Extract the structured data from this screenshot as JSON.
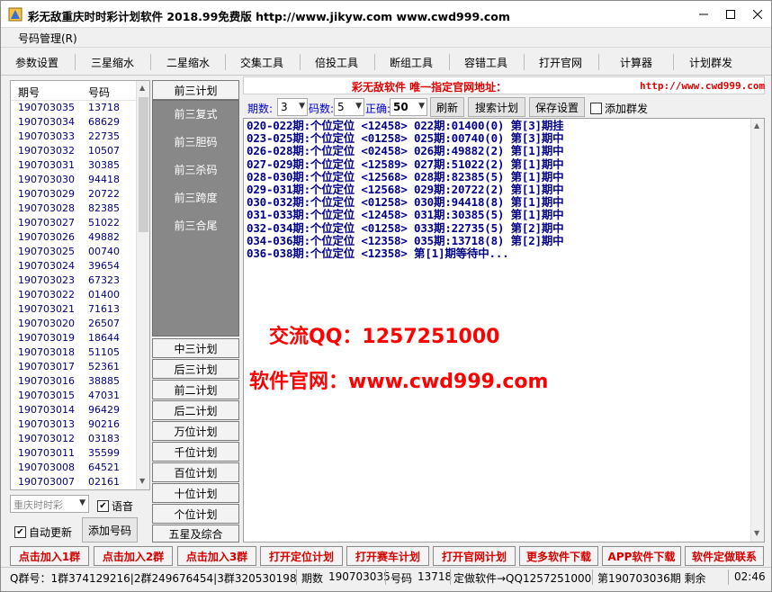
{
  "window": {
    "title": "彩无敌重庆时时彩计划软件 2018.99免费版 http://www.jikyw.com www.cwd999.com"
  },
  "menu": {
    "haoma": "号码管理(R)"
  },
  "toolbar": [
    "参数设置",
    "三星缩水",
    "二星缩水",
    "交集工具",
    "倍投工具",
    "断组工具",
    "容错工具",
    "打开官网",
    "计算器",
    "计划群发"
  ],
  "table": {
    "col_period": "期号",
    "col_number": "号码",
    "rows": [
      [
        "190703035",
        "13718"
      ],
      [
        "190703034",
        "68629"
      ],
      [
        "190703033",
        "22735"
      ],
      [
        "190703032",
        "10507"
      ],
      [
        "190703031",
        "30385"
      ],
      [
        "190703030",
        "94418"
      ],
      [
        "190703029",
        "20722"
      ],
      [
        "190703028",
        "82385"
      ],
      [
        "190703027",
        "51022"
      ],
      [
        "190703026",
        "49882"
      ],
      [
        "190703025",
        "00740"
      ],
      [
        "190703024",
        "39654"
      ],
      [
        "190703023",
        "67323"
      ],
      [
        "190703022",
        "01400"
      ],
      [
        "190703021",
        "71613"
      ],
      [
        "190703020",
        "26507"
      ],
      [
        "190703019",
        "18644"
      ],
      [
        "190703018",
        "51105"
      ],
      [
        "190703017",
        "52361"
      ],
      [
        "190703016",
        "38885"
      ],
      [
        "190703015",
        "47031"
      ],
      [
        "190703014",
        "96429"
      ],
      [
        "190703013",
        "90216"
      ],
      [
        "190703012",
        "03183"
      ],
      [
        "190703011",
        "35599"
      ],
      [
        "190703008",
        "64521"
      ],
      [
        "190703007",
        "02161"
      ]
    ]
  },
  "left_controls": {
    "lottery_select": "重庆时时彩",
    "voice_label": "语音",
    "auto_update_label": "自动更新",
    "add_number_button": "添加号码"
  },
  "plan_column": {
    "top_button": "前三计划",
    "grey_items": [
      "前三复式",
      "前三胆码",
      "前三杀码",
      "前三跨度",
      "前三合尾"
    ],
    "buttons": [
      "中三计划",
      "后三计划",
      "前二计划",
      "后二计划",
      "万位计划",
      "千位计划",
      "百位计划",
      "十位计划",
      "个位计划",
      "五星及综合"
    ]
  },
  "header": {
    "text": "彩无敌软件  唯一指定官网地址：",
    "url": "http://www.cwd999.com"
  },
  "controls": {
    "period_label": "期数:",
    "period_value": "3",
    "code_label": "码数:",
    "code_value": "5",
    "correct_label": "正确:",
    "correct_value": "50",
    "refresh_button": "刷新",
    "search_button": "搜索计划",
    "save_button": "保存设置",
    "group_send_label": "添加群发"
  },
  "output_lines": [
    "020-022期:个位定位 <12458> 022期:01400(0) 第[3]期挂",
    "023-025期:个位定位 <01258> 025期:00740(0) 第[3]期中",
    "026-028期:个位定位 <02458> 026期:49882(2) 第[1]期中",
    "027-029期:个位定位 <12589> 027期:51022(2) 第[1]期中",
    "028-030期:个位定位 <12568> 028期:82385(5) 第[1]期中",
    "029-031期:个位定位 <12568> 029期:20722(2) 第[1]期中",
    "030-032期:个位定位 <01258> 030期:94418(8) 第[1]期中",
    "031-033期:个位定位 <12458> 031期:30385(5) 第[1]期中",
    "032-034期:个位定位 <01258> 033期:22735(5) 第[2]期中",
    "034-036期:个位定位 <12358> 035期:13718(8) 第[2]期中",
    "036-038期:个位定位 <12358> 第[1]期等待中..."
  ],
  "promo": {
    "qq": "交流QQ：1257251000",
    "site": "软件官网：www.cwd999.com"
  },
  "bottom_buttons": [
    "点击加入1群",
    "点击加入2群",
    "点击加入3群",
    "打开定位计划",
    "打开赛车计划",
    "打开官网计划",
    "更多软件下载",
    "APP软件下载",
    "软件定做联系"
  ],
  "status": {
    "groups": "Q群号：1群374129216|2群249676454|3群320530198",
    "period_label": "期数",
    "period_value": "190703035",
    "number_label": "号码",
    "number_value": "13718",
    "custom": "定做软件→QQ1257251000",
    "next_period": "第190703036期 剩余",
    "time": "02:46"
  },
  "colors": {
    "red": "#e00000",
    "navy": "#00008b",
    "grey_panel": "#888888"
  }
}
